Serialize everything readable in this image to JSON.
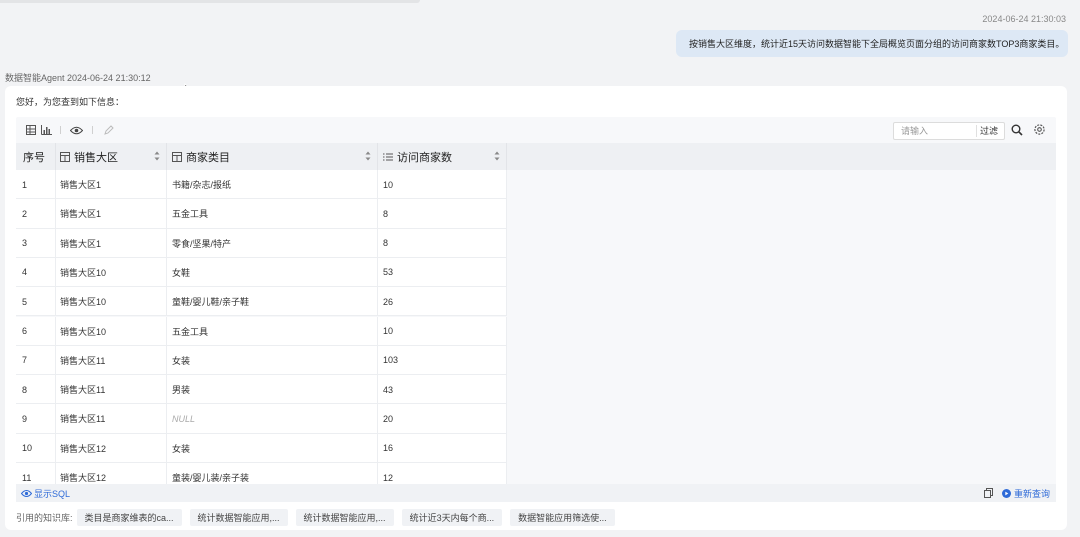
{
  "conversation": {
    "user_timestamp": "2024-06-24 21:30:03",
    "user_message": "按销售大区维度，统计近15天访问数据智能下全局概览页面分组的访问商家数TOP3商家类目。",
    "agent_label": "数据智能Agent 2024-06-24 21:30:12",
    "greeting": "您好，为您查到如下信息："
  },
  "toolbar": {
    "search_placeholder": "请输入",
    "filter_label": "过滤"
  },
  "table": {
    "columns": [
      {
        "label": "序号",
        "icon": ""
      },
      {
        "label": "销售大区",
        "icon": "dimension-icon"
      },
      {
        "label": "商家类目",
        "icon": "dimension-icon"
      },
      {
        "label": "访问商家数",
        "icon": "measure-icon"
      }
    ],
    "rows": [
      [
        "1",
        "销售大区1",
        "书籍/杂志/报纸",
        "10"
      ],
      [
        "2",
        "销售大区1",
        "五金工具",
        "8"
      ],
      [
        "3",
        "销售大区1",
        "零食/坚果/特产",
        "8"
      ],
      [
        "4",
        "销售大区10",
        "女鞋",
        "53"
      ],
      [
        "5",
        "销售大区10",
        "童鞋/婴儿鞋/亲子鞋",
        "26"
      ],
      [
        "6",
        "销售大区10",
        "五金工具",
        "10"
      ],
      [
        "7",
        "销售大区11",
        "女装",
        "103"
      ],
      [
        "8",
        "销售大区11",
        "男装",
        "43"
      ],
      [
        "9",
        "销售大区11",
        "NULL",
        "20"
      ],
      [
        "10",
        "销售大区12",
        "女装",
        "16"
      ],
      [
        "11",
        "销售大区12",
        "童装/婴儿装/亲子装",
        "12"
      ]
    ]
  },
  "footer": {
    "show_sql_label": "显示SQL",
    "requery_label": "重新查询"
  },
  "knowledge": {
    "label": "引用的知识库:",
    "items": [
      "类目是商家维表的ca...",
      "统计数据智能应用,...",
      "统计数据智能应用,...",
      "统计近3天内每个商...",
      "数据智能应用筛选使..."
    ]
  },
  "colors": {
    "accent": "#2f6bd8",
    "user_bubble": "#dde8f5",
    "page_bg": "#f2f3f5"
  }
}
